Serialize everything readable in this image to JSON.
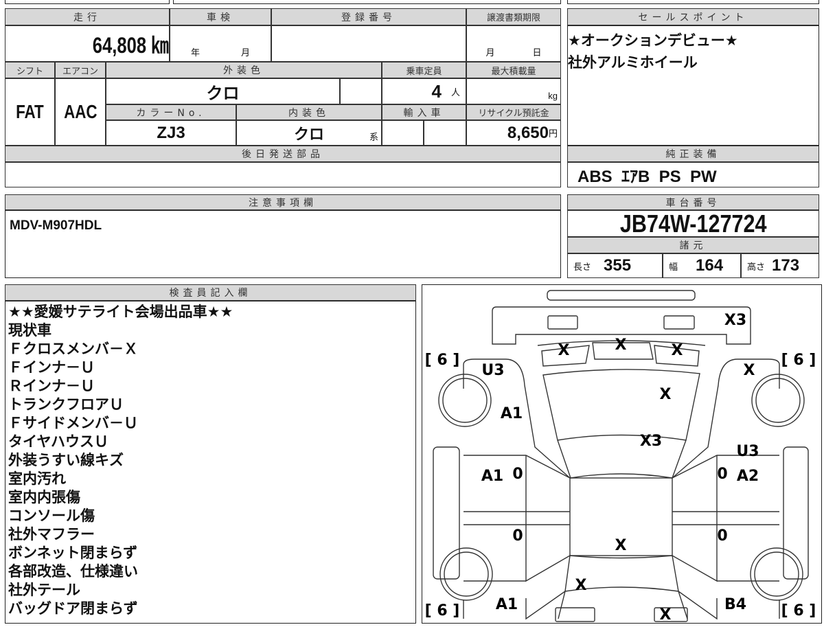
{
  "main_table": {
    "headers": {
      "mileage": "走行",
      "inspection": "車検",
      "registration": "登録番号",
      "transfer_deadline": "譲渡書類期限",
      "shift": "シフト",
      "aircon": "エアコン",
      "exterior_color": "外装色",
      "capacity": "乗車定員",
      "max_load": "最大積載量",
      "color_no": "カラーNo.",
      "interior_color": "内装色",
      "import": "輸入車",
      "recycle_fee": "リサイクル預託金",
      "later_parts": "後日発送部品"
    },
    "mileage": "64,808 ㎞",
    "inspection_year": "年",
    "inspection_month": "月",
    "deadline_month": "月",
    "deadline_day": "日",
    "shift": "FAT",
    "aircon": "AAC",
    "exterior_color": "クロ",
    "capacity": "4",
    "capacity_unit": "人",
    "max_load_unit": "kg",
    "color_no": "ZJ3",
    "interior_color": "クロ",
    "interior_suffix": "系",
    "recycle_fee": "8,650",
    "recycle_unit": "円"
  },
  "sales_point": {
    "header": "セールスポイント",
    "lines": [
      "★オークションデビュー★",
      "社外アルミホイール"
    ]
  },
  "equipment": {
    "header": "純正装備",
    "value": "ABS  ｴｱB  PS  PW"
  },
  "notes": {
    "header": "注意事項欄",
    "value": "MDV-M907HDL"
  },
  "chassis": {
    "header": "車台番号",
    "value": "JB74W-127724",
    "spec_header": "諸元",
    "length_label": "長さ",
    "length": "355",
    "width_label": "幅",
    "width": "164",
    "height_label": "高さ",
    "height": "173"
  },
  "inspector": {
    "header": "検査員記入欄",
    "lines": [
      "★★愛媛サテライト会場出品車★★",
      "現状車",
      "Ｆクロスメンバ－Ｘ",
      "Ｆインナ－Ｕ",
      "Ｒインナ－Ｕ",
      "トランクフロアＵ",
      "Ｆサイドメンバ－Ｕ",
      "タイヤハウスＵ",
      "外装うすい線キズ",
      "室内汚れ",
      "室内内張傷",
      "コンソール傷",
      "社外マフラー",
      "ボンネット閉まらず",
      "各部改造、仕様違い",
      "社外テール",
      "バッグドア閉まらず"
    ]
  },
  "diagram": {
    "marks": [
      "X3",
      "X",
      "X",
      "X",
      "U3",
      "X",
      "X",
      "A1",
      "X3",
      "U3",
      "A1",
      "0",
      "0",
      "A2",
      "0",
      "0",
      "X",
      "X",
      "A1",
      "B4",
      "X",
      "[ 6 ]",
      "[ 6 ]",
      "[ 6 ]",
      "[ 6 ]"
    ]
  }
}
